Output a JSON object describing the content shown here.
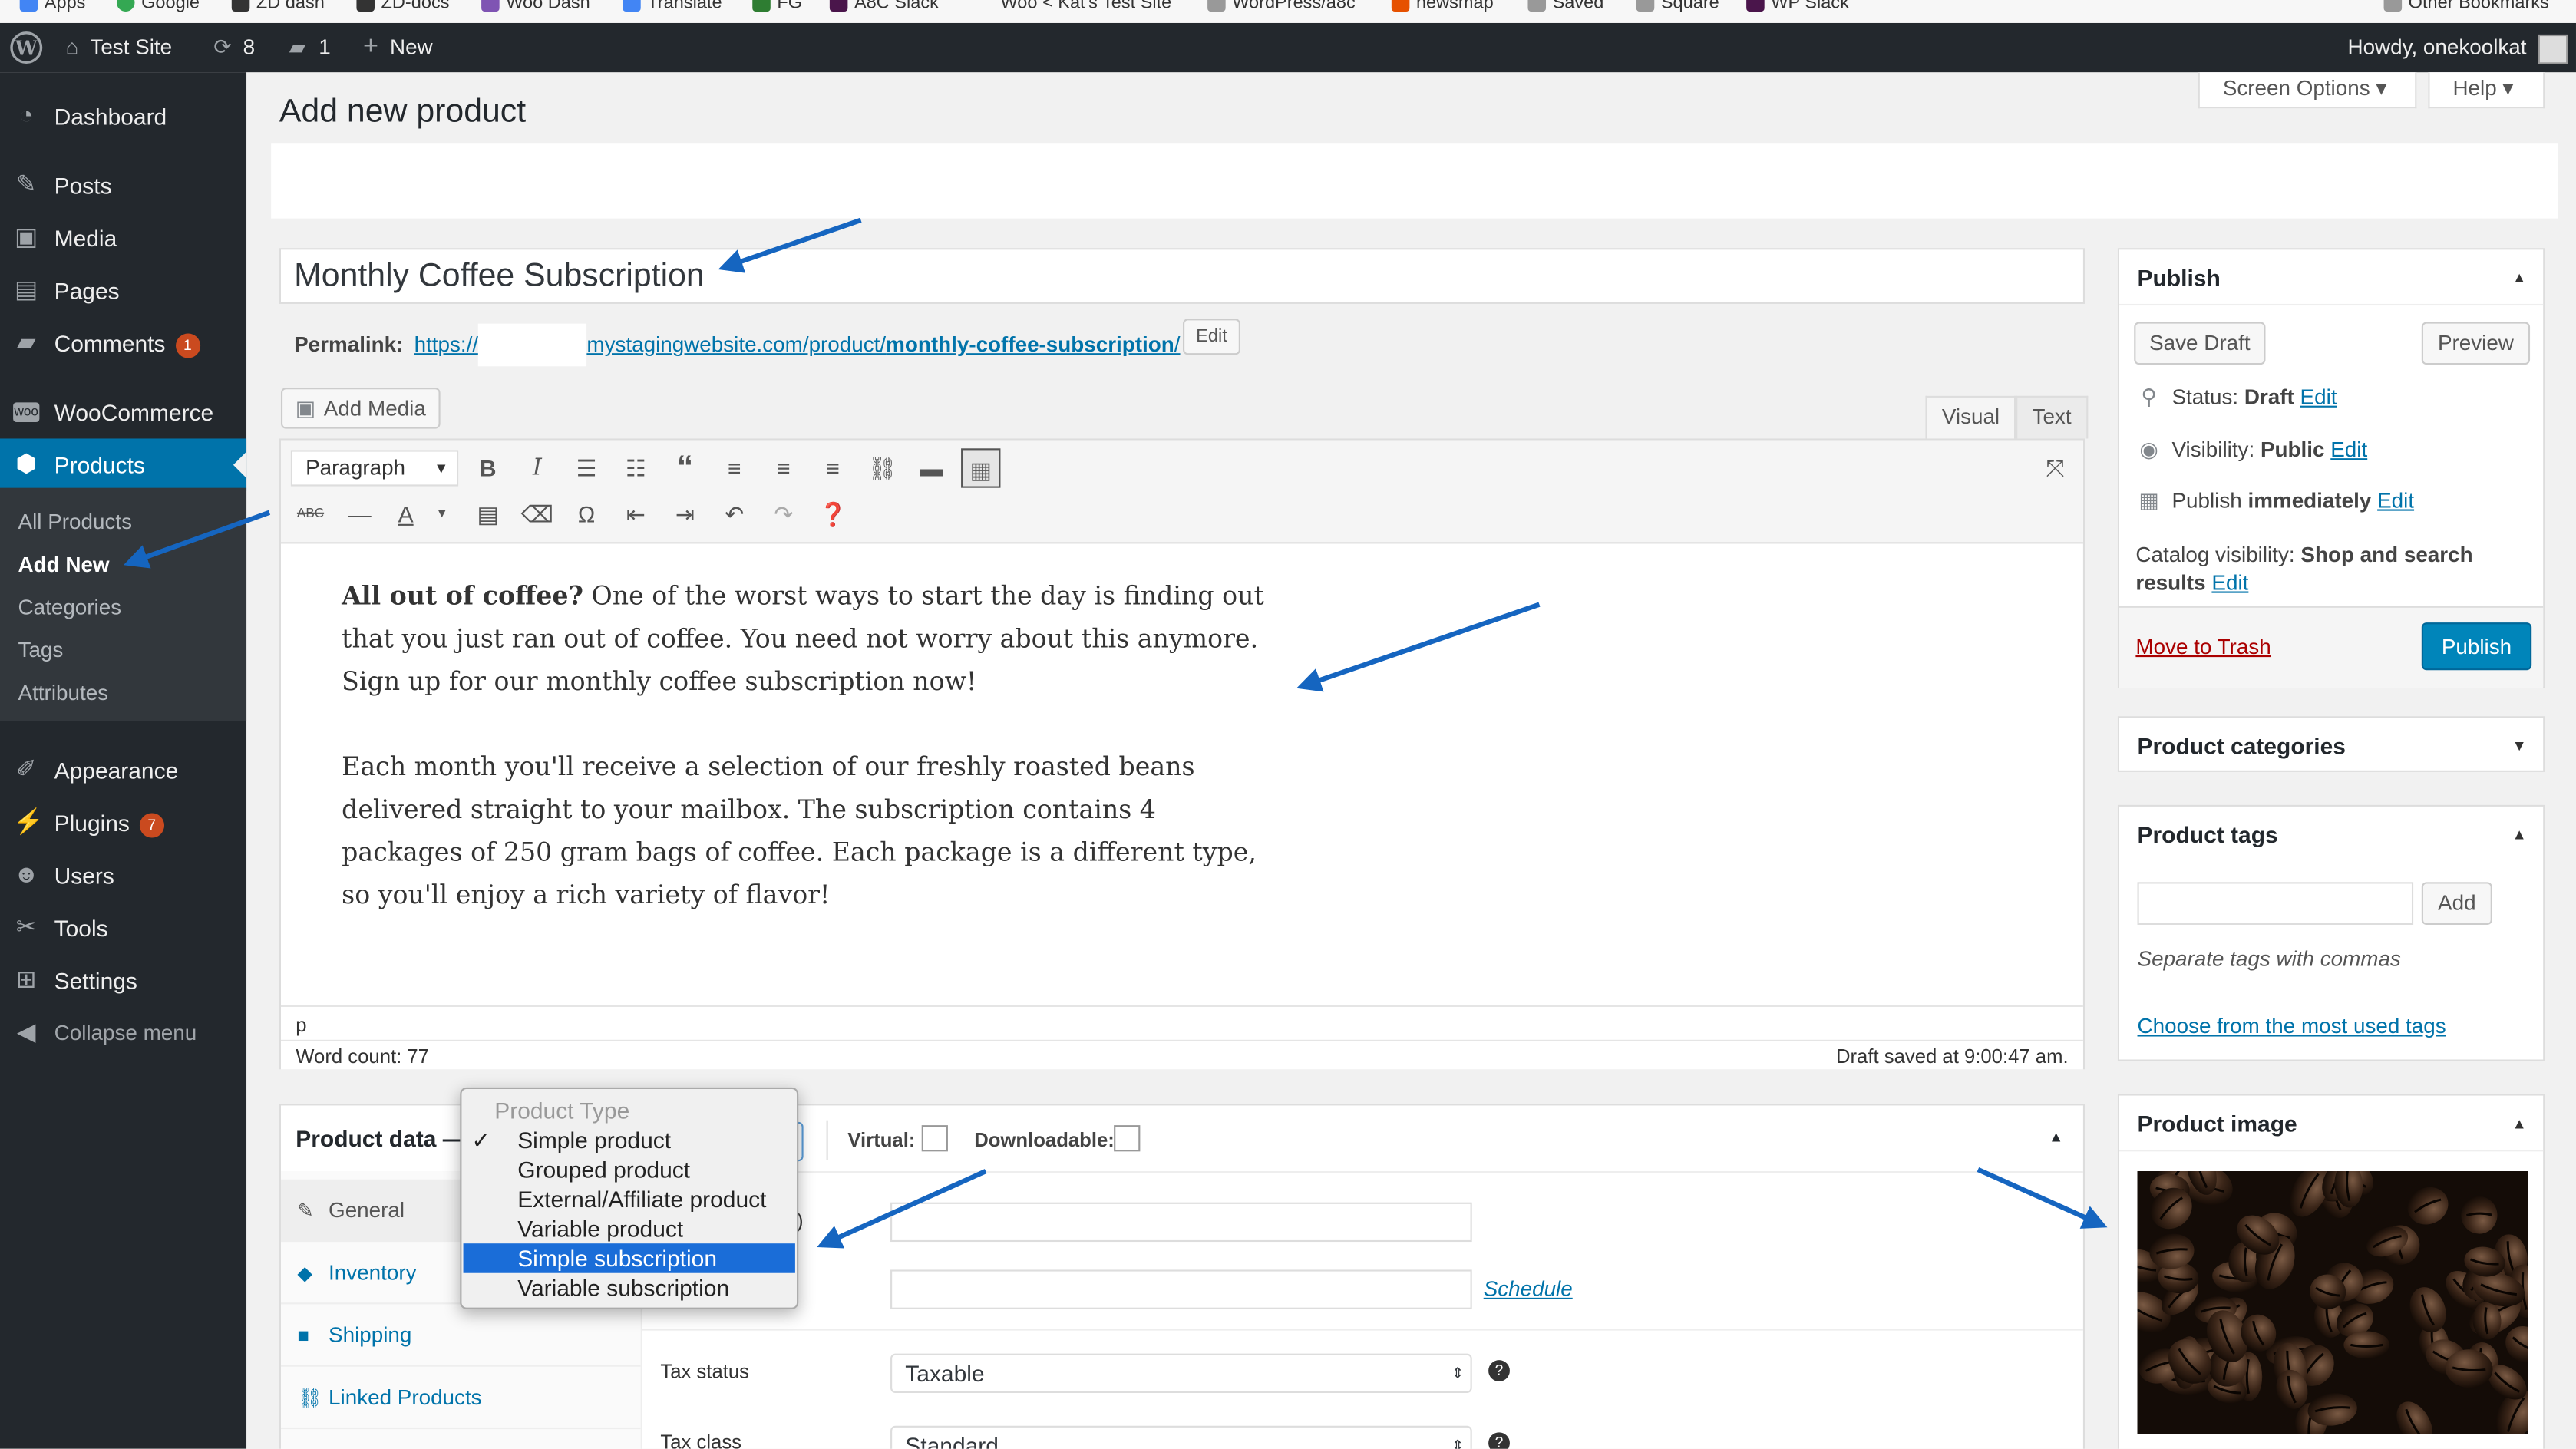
{
  "bookmarks": [
    {
      "label": "Apps",
      "color": "#4285f4"
    },
    {
      "label": "Google",
      "color": "#34a853"
    },
    {
      "label": "ZD dash",
      "color": "#333333"
    },
    {
      "label": "ZD-docs",
      "color": "#333333"
    },
    {
      "label": "Woo Dash",
      "color": "#7f54b3"
    },
    {
      "label": "Translate",
      "color": "#4285f4"
    },
    {
      "label": "FG",
      "color": "#2e7d32"
    },
    {
      "label": "A8C Slack",
      "color": "#4a154b"
    },
    {
      "label": "Woo < Kat's Test Site",
      "color": "#ffffff"
    },
    {
      "label": "WordPress/a8c",
      "color": "#999999"
    },
    {
      "label": "newsmap",
      "color": "#e65100"
    },
    {
      "label": "Saved",
      "color": "#999999"
    },
    {
      "label": "Square",
      "color": "#999999"
    },
    {
      "label": "WP Slack",
      "color": "#4a154b"
    }
  ],
  "bookmarks_other": "Other Bookmarks",
  "adminbar": {
    "site_name": "Test Site",
    "updates_count": "8",
    "comments_count": "1",
    "new_label": "New",
    "greeting": "Howdy, onekoolkat"
  },
  "sidebar": {
    "items": [
      {
        "label": "Dashboard",
        "icon": "dashboard-icon"
      },
      {
        "label": "Posts",
        "icon": "pin-icon"
      },
      {
        "label": "Media",
        "icon": "media-icon"
      },
      {
        "label": "Pages",
        "icon": "pages-icon"
      },
      {
        "label": "Comments",
        "icon": "comment-icon",
        "badge": "1"
      },
      {
        "label": "WooCommerce",
        "icon": "woo-icon"
      },
      {
        "label": "Products",
        "icon": "box-icon"
      },
      {
        "label": "Appearance",
        "icon": "brush-icon"
      },
      {
        "label": "Plugins",
        "icon": "plug-icon",
        "badge": "7"
      },
      {
        "label": "Users",
        "icon": "user-icon"
      },
      {
        "label": "Tools",
        "icon": "wrench-icon"
      },
      {
        "label": "Settings",
        "icon": "settings-icon"
      }
    ],
    "submenu": [
      "All Products",
      "Add New",
      "Categories",
      "Tags",
      "Attributes"
    ],
    "collapse": "Collapse menu"
  },
  "header": {
    "screen_options": "Screen Options ▾",
    "help": "Help ▾",
    "page_title": "Add new product"
  },
  "product": {
    "title": "Monthly Coffee Subscription",
    "permalink_label": "Permalink:",
    "permalink_prefix": "https://",
    "permalink_domain": "mystagingwebsite.com/product/",
    "permalink_slug": "monthly-coffee-subscription",
    "permalink_suffix": "/",
    "edit_label": "Edit"
  },
  "editor": {
    "add_media": "Add Media",
    "tab_visual": "Visual",
    "tab_text": "Text",
    "paragraph": "Paragraph",
    "p1_bold": "All out of coffee?",
    "p1_rest": " One of the worst ways to start the day is finding out that you just ran out of coffee. You need not worry about this anymore. Sign up for our monthly coffee subscription now!",
    "p2": "Each month you'll receive a selection of our freshly roasted beans delivered straight to your mailbox. The subscription contains 4 packages of 250 gram bags of coffee. Each package is a different type, so you'll enjoy a rich variety of flavor!",
    "path": "p",
    "word_count": "Word count: 77",
    "draft_saved": "Draft saved at 9:00:47 am."
  },
  "product_data": {
    "title": "Product data —",
    "virtual_label": "Virtual:",
    "downloadable_label": "Downloadable:",
    "tabs": [
      "General",
      "Inventory",
      "Shipping",
      "Linked Products"
    ],
    "schedule": "Schedule",
    "tax_status_label": "Tax status",
    "tax_status_value": "Taxable",
    "tax_class_label": "Tax class",
    "tax_class_value": "Standard",
    "field_hint": "s)"
  },
  "product_type_dropdown": {
    "header": "Product Type",
    "options": [
      "Simple product",
      "Grouped product",
      "External/Affiliate product",
      "Variable product",
      "Simple subscription",
      "Variable subscription"
    ],
    "checked": "Simple product",
    "highlighted": "Simple subscription"
  },
  "publish": {
    "title": "Publish",
    "save_draft": "Save Draft",
    "preview": "Preview",
    "status_label": "Status:",
    "status_value": "Draft",
    "visibility_label": "Visibility:",
    "visibility_value": "Public",
    "publish_label": "Publish",
    "publish_value": "immediately",
    "catalog_label": "Catalog visibility:",
    "catalog_value_1": "Shop and search",
    "catalog_value_2": "results",
    "edit": "Edit",
    "trash": "Move to Trash",
    "publish_button": "Publish"
  },
  "categories": {
    "title": "Product categories"
  },
  "tags": {
    "title": "Product tags",
    "add": "Add",
    "hint": "Separate tags with commas",
    "choose": "Choose from the most used tags"
  },
  "image": {
    "title": "Product image"
  },
  "colors": {
    "accent": "#0073aa",
    "adminbar": "#23282d",
    "annotation_arrow": "#1565c0",
    "primary_button": "#0085ba"
  }
}
